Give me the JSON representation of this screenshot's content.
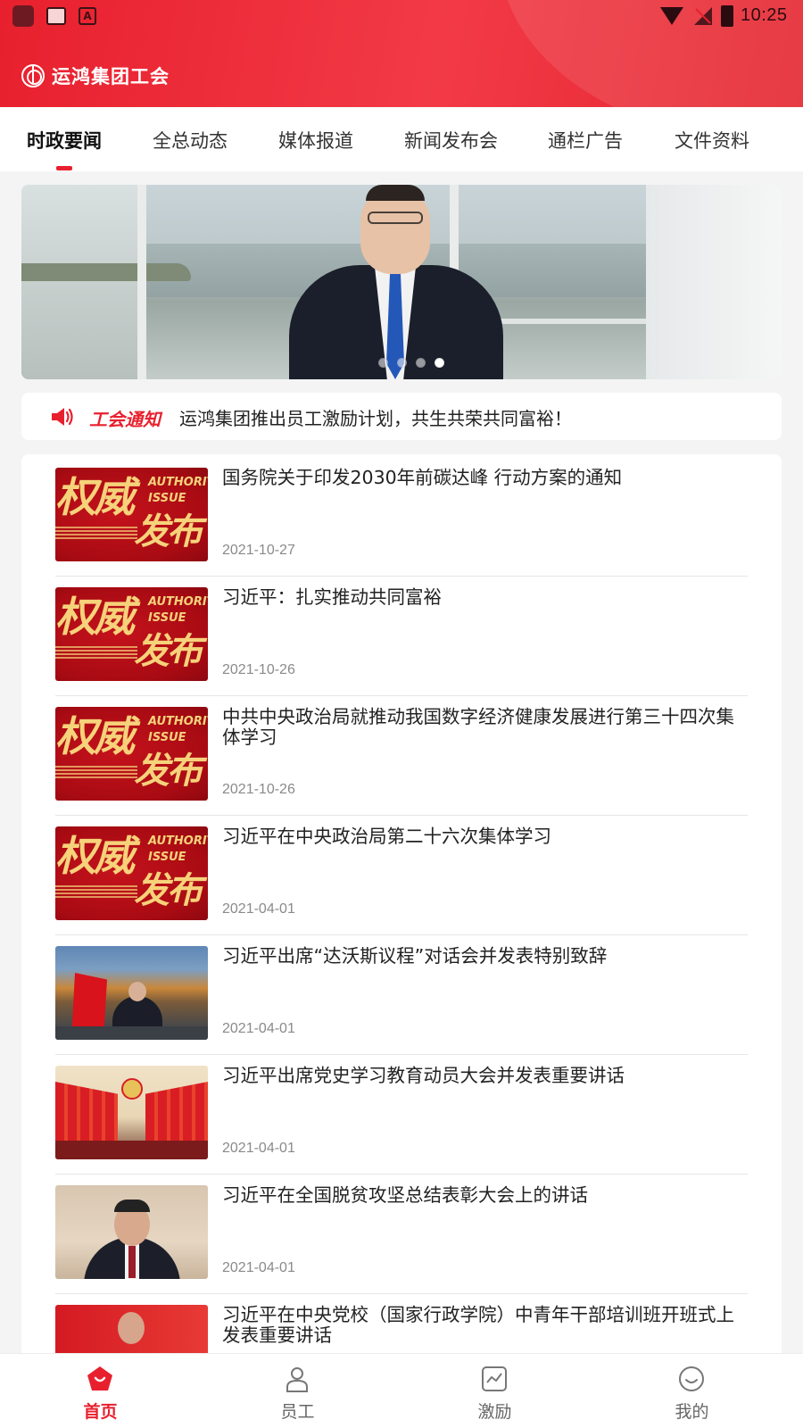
{
  "status_bar": {
    "time": "10:25"
  },
  "header": {
    "title": "运鸿集团工会",
    "logo_icon": "union-logo-icon"
  },
  "tabs": [
    {
      "label": "时政要闻",
      "active": true
    },
    {
      "label": "全总动态"
    },
    {
      "label": "媒体报道"
    },
    {
      "label": "新闻发布会"
    },
    {
      "label": "通栏广告"
    },
    {
      "label": "文件资料"
    }
  ],
  "banner": {
    "slide_count": 4,
    "active_slide": 4
  },
  "notice": {
    "label": "工会通知",
    "icon": "megaphone-icon",
    "text": "运鸿集团推出员工激励计划，共生共荣共同富裕！"
  },
  "thumb_text": {
    "cn_line1": "权威",
    "cn_line2": "发布",
    "en_line1": "AUTHORITY",
    "en_line2": "ISSUE"
  },
  "news": [
    {
      "title": "国务院关于印发2030年前碳达峰 行动方案的通知",
      "date": "2021-10-27",
      "thumb": "authority-issue"
    },
    {
      "title": "习近平：扎实推动共同富裕",
      "date": "2021-10-26",
      "thumb": "authority-issue"
    },
    {
      "title": "中共中央政治局就推动我国数字经济健康发展进行第三十四次集体学习",
      "date": "2021-10-26",
      "thumb": "authority-issue"
    },
    {
      "title": "习近平在中央政治局第二十六次集体学习",
      "date": "2021-04-01",
      "thumb": "authority-issue"
    },
    {
      "title": "习近平出席“达沃斯议程”对话会并发表特别致辞",
      "date": "2021-04-01",
      "thumb": "davos-photo"
    },
    {
      "title": "习近平出席党史学习教育动员大会并发表重要讲话",
      "date": "2021-04-01",
      "thumb": "party-meeting-photo"
    },
    {
      "title": "习近平在全国脱贫攻坚总结表彰大会上的讲话",
      "date": "2021-04-01",
      "thumb": "speech-photo"
    },
    {
      "title": "习近平在中央党校（国家行政学院）中青年干部培训班开班式上发表重要讲话",
      "date": "",
      "thumb": "red-photo"
    }
  ],
  "bottom_nav": [
    {
      "label": "首页",
      "icon": "home-icon",
      "active": true
    },
    {
      "label": "员工",
      "icon": "person-icon"
    },
    {
      "label": "激励",
      "icon": "chart-icon"
    },
    {
      "label": "我的",
      "icon": "smile-icon"
    }
  ],
  "colors": {
    "brand_red": "#e8202e",
    "text_dark": "#222222",
    "date_gray": "#8a8a8a",
    "page_bg": "#f4f4f4"
  }
}
